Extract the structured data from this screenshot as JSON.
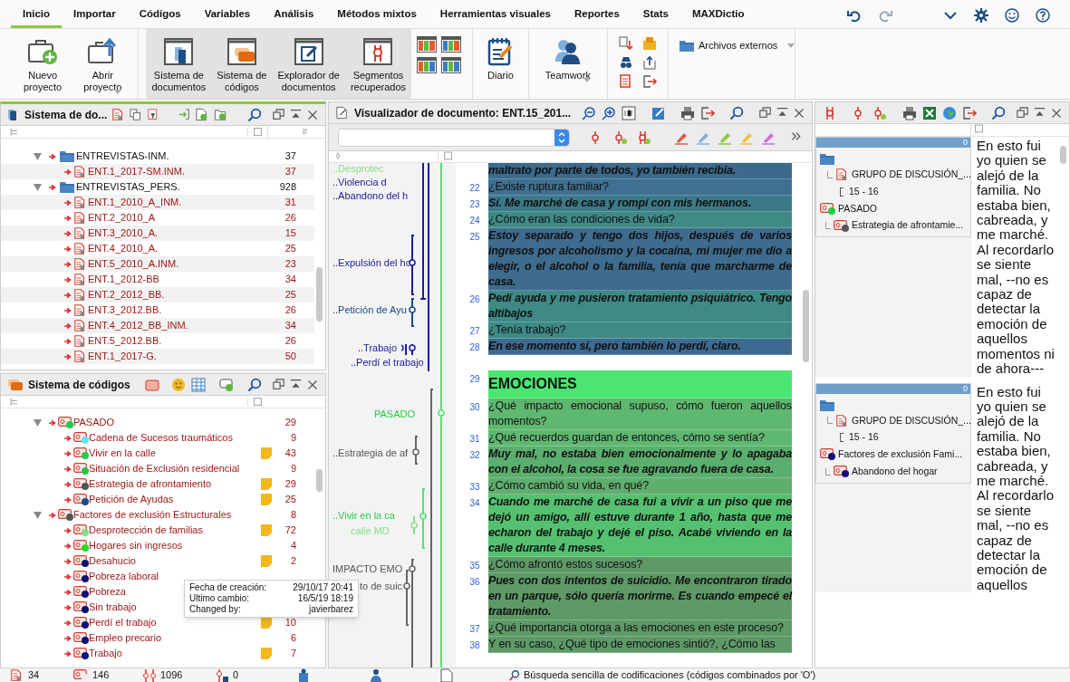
{
  "menu_tabs": [
    {
      "label": "Inicio",
      "selected": true
    },
    {
      "label": "Importar",
      "selected": false
    },
    {
      "label": "Códigos",
      "selected": false
    },
    {
      "label": "Variables",
      "selected": false
    },
    {
      "label": "Análisis",
      "selected": false
    },
    {
      "label": "Métodos mixtos",
      "selected": false
    },
    {
      "label": "Herramientas visuales",
      "selected": false
    },
    {
      "label": "Reportes",
      "selected": false
    },
    {
      "label": "Stats",
      "selected": false
    },
    {
      "label": "MAXDictio",
      "selected": false
    }
  ],
  "ribbon": {
    "project_buttons": [
      {
        "label": "Nuevo\nproyecto",
        "menu": false
      },
      {
        "label": "Abrir\nproyecto",
        "menu": true
      }
    ],
    "window_buttons": [
      {
        "label": "Sistema de\ndocumentos",
        "selected": true
      },
      {
        "label": "Sistema de\ncódigos",
        "selected": true
      },
      {
        "label": "Explorador de\ndocumentos",
        "selected": true
      },
      {
        "label": "Segmentos\nrecuperados",
        "selected": true
      }
    ],
    "diary_button": {
      "label": "Diario"
    },
    "teamwork_button": {
      "label": "Teamwork",
      "menu": true
    },
    "external_files": {
      "label": "Archivos externos",
      "menu": true
    }
  },
  "document_system": {
    "title": "Sistema de do...",
    "column_3": "#",
    "items": [
      {
        "name": "ENTREVISTAS-INM.",
        "count": "37",
        "expanded": true,
        "children": [
          {
            "name": "ENT.1_2017-SM.INM.",
            "count": "37"
          }
        ]
      },
      {
        "name": "ENTREVISTAS_PERS.",
        "count": "928",
        "expanded": true,
        "children": [
          {
            "name": "ENT.1_2010_A_INM.",
            "count": "31"
          },
          {
            "name": "ENT.2_2010_A",
            "count": "26"
          },
          {
            "name": "ENT.3_2010_A.",
            "count": "15"
          },
          {
            "name": "ENT.4_2010_A.",
            "count": "25"
          },
          {
            "name": "ENT.5_2010_A.INM.",
            "count": "23"
          },
          {
            "name": "ENT.1_2012-BB",
            "count": "34"
          },
          {
            "name": "ENT.2_2012_BB.",
            "count": "25"
          },
          {
            "name": "ENT.3_2012.BB.",
            "count": "26"
          },
          {
            "name": "ENT.4_2012_BB_INM.",
            "count": "34"
          },
          {
            "name": "ENT.5_2012.BB.",
            "count": "26"
          },
          {
            "name": "ENT.1_2017-G.",
            "count": "50"
          }
        ]
      }
    ]
  },
  "code_system": {
    "title": "Sistema de códigos",
    "items": [
      {
        "name": "PASADO",
        "count": "29",
        "color": "#22cc44",
        "memo": false,
        "expanded": true,
        "children": [
          {
            "name": "Cadena de Sucesos traumáticos",
            "count": "9",
            "color": "#66e0ee",
            "memo": false
          },
          {
            "name": "Vivir en la calle",
            "count": "43",
            "color": "#22cc44",
            "memo": true
          },
          {
            "name": "Situación de Exclusión residencial",
            "count": "9",
            "color": "#22cc44",
            "memo": false
          },
          {
            "name": "Estrategia de afrontamiento",
            "count": "29",
            "color": "#555555",
            "memo": true
          },
          {
            "name": "Petición de Ayudas",
            "count": "25",
            "color": "#1a4a8a",
            "memo": true
          }
        ]
      },
      {
        "name": "Factores de exclusión Estructurales",
        "count": "8",
        "color": "#555555",
        "memo": false,
        "expanded": true,
        "children": [
          {
            "name": "Desprotección de familias",
            "count": "72",
            "color": "#88dd88",
            "memo": true
          },
          {
            "name": "Hogares sin ingresos",
            "count": "4",
            "color": "#22dd22",
            "memo": false
          },
          {
            "name": "Desahucio",
            "count": "2",
            "color": "#10107a",
            "memo": true
          },
          {
            "name": "Pobreza laboral",
            "color": "#10107a",
            "memo": false
          },
          {
            "name": "Pobreza",
            "color": "#10107a",
            "memo": false
          },
          {
            "name": "Sin trabajo",
            "color": "#10107a",
            "memo": false
          },
          {
            "name": "Perdí el trabajo",
            "count": "10",
            "color": "#10107a",
            "memo": true
          },
          {
            "name": "Empleo precario",
            "count": "6",
            "color": "#10107a",
            "memo": false
          },
          {
            "name": "Trabajo",
            "count": "7",
            "color": "#10107a",
            "memo": true
          }
        ]
      }
    ]
  },
  "tooltip": [
    {
      "label": "Fecha de creación:",
      "value": "29/10/17 20:41"
    },
    {
      "label": "Ultimo cambio:",
      "value": "16/5/19 18:19"
    },
    {
      "label": "Changed by:",
      "value": "javierbarez"
    }
  ],
  "document_viewer": {
    "title": "Visualizador de documento: ENT.15_201...",
    "margin_labels": [
      {
        "text": "..Desprotec",
        "color": "#88dd88"
      },
      {
        "text": "..Violencia d",
        "color": "#1a1a9a"
      },
      {
        "text": "..Abandono del h",
        "color": "#1a1a9a"
      },
      {
        "text": "..Expulsión del hc",
        "color": "#1a1a9a"
      },
      {
        "text": "..Petición de Ayu",
        "color": "#1a4a8a"
      },
      {
        "text": "..Trabajo",
        "color": "#1a1a9a"
      },
      {
        "text": "..Perdí el trabajo",
        "color": "#1a1a9a"
      },
      {
        "text": "PASADO",
        "color": "#22cc44"
      },
      {
        "text": "..Estrategia de af",
        "color": "#555555"
      },
      {
        "text": "..Vivir en la ca",
        "color": "#22cc44"
      },
      {
        "text": "calle MD",
        "color": "#88dd88"
      },
      {
        "text": "IMPACTO EMO",
        "color": "#555555"
      },
      {
        "text": "to de suic",
        "color": "#555555"
      }
    ],
    "paragraphs": [
      {
        "kind": "answer",
        "text": "maltrato por parte de todos, yo también recibía.",
        "color": "#3b6a8c"
      },
      {
        "number": "22",
        "kind": "question",
        "text": "¿Existe ruptura familiar?",
        "color": "#3e7090"
      },
      {
        "number": "23",
        "kind": "answer",
        "text": "Sí. Me marché de casa y rompí con mis hermanos.",
        "color": "#3b7a88"
      },
      {
        "number": "24",
        "kind": "question",
        "text": "¿Cómo eran las condiciones de vida?",
        "color": "#3f8a85"
      },
      {
        "number": "25",
        "kind": "answer",
        "text": "Estoy separado y tengo dos hijos, después de varios ingresos por alcoholismo y la cocaína, mi mujer me dio a elegir, o el alcohol o la familia, tenía que marcharme de casa.",
        "color": "#3e6c8e"
      },
      {
        "number": "26",
        "kind": "answer",
        "text": "Pedí ayuda y me pusieron tratamiento psiquiátrico. Tengo altibajos",
        "color": "#3d8a86"
      },
      {
        "number": "27",
        "kind": "question",
        "text": "¿Tenía trabajo?",
        "color": "#3d8a86"
      },
      {
        "number": "28",
        "kind": "answer",
        "text": "En ese momento sí, pero también lo perdí, claro.",
        "color": "#3d6a90"
      },
      {
        "number": "29",
        "kind": "heading",
        "text": "EMOCIONES",
        "color": "#4be572"
      },
      {
        "number": "30",
        "kind": "question",
        "text": "¿Qué impacto emocional supuso, cómo fueron aquellos momentos?",
        "color": "#5fb870"
      },
      {
        "number": "31",
        "kind": "question",
        "text": "¿Qué recuerdos guardan de entonces, cómo se sentía?",
        "color": "#5fb870"
      },
      {
        "number": "32",
        "kind": "answer",
        "text": "Muy mal, no estaba bien emocionalmente y lo apagaba con el alcohol, la cosa se fue agravando fuera de casa.",
        "color": "#5aae6e"
      },
      {
        "number": "33",
        "kind": "question",
        "text": "¿Cómo cambió su vida, en qué?",
        "color": "#5fae6e"
      },
      {
        "number": "34",
        "kind": "answer",
        "text": "Cuando me marché de casa fui a vivir a un piso que me dejó un amigo, allí estuve durante 1 año, hasta que me echaron del trabajo y dejé el piso. Acabé viviendo en la calle durante 4 meses.",
        "color": "#55c070"
      },
      {
        "number": "35",
        "kind": "question",
        "text": "¿Cómo afrontó estos sucesos?",
        "color": "#5e9a68"
      },
      {
        "number": "36",
        "kind": "answer",
        "text": "Pues con dos intentos de suicidio. Me encontraron tirado en un parque, sólo quería morirme. Es cuando empecé el tratamiento.",
        "color": "#5e9a68"
      },
      {
        "number": "37",
        "kind": "question",
        "text": "¿Qué importancia otorga a las emociones en este proceso?",
        "color": "#5e9a68"
      },
      {
        "number": "38",
        "kind": "question",
        "text": "Y en su caso, ¿Qué tipo de emociones sintió?, ¿Cómo las",
        "color": "#5e9a68"
      }
    ]
  },
  "retrieved_segments": [
    {
      "weight": "0",
      "document": "GRUPO DE DISCUSIÓN_...",
      "range": "15 - 16",
      "code": {
        "name": "PASADO",
        "color": "#22cc44",
        "children": [
          {
            "name": "Estrategia de afrontamie...",
            "color": "#555555"
          }
        ]
      },
      "text": "En esto fui yo quien se alejó de la familia. No estaba bien, cabreada, y me marché. Al recordarlo se siente mal, --no es capaz de detectar la emoción de aquellos momentos ni de ahora---"
    },
    {
      "weight": "0",
      "document": "GRUPO DE DISCUSIÓN_...",
      "range": "15 - 16",
      "code": {
        "name": "Factores de exclusión Fami...",
        "color": "#10107a",
        "children": [
          {
            "name": "Abandono del hogar",
            "color": "#10107a"
          }
        ]
      },
      "text": "En esto fui yo quien se alejó de la familia. No estaba bien, cabreada, y me marché. Al recordarlo se siente mal, --no es capaz de detectar la emoción de aquellos"
    }
  ],
  "status_bar": {
    "documents": "34",
    "codes": "146",
    "segments": "1096",
    "memos": "0",
    "search_mode": "Búsqueda sencilla de codificaciones (códigos combinados por 'O')"
  }
}
